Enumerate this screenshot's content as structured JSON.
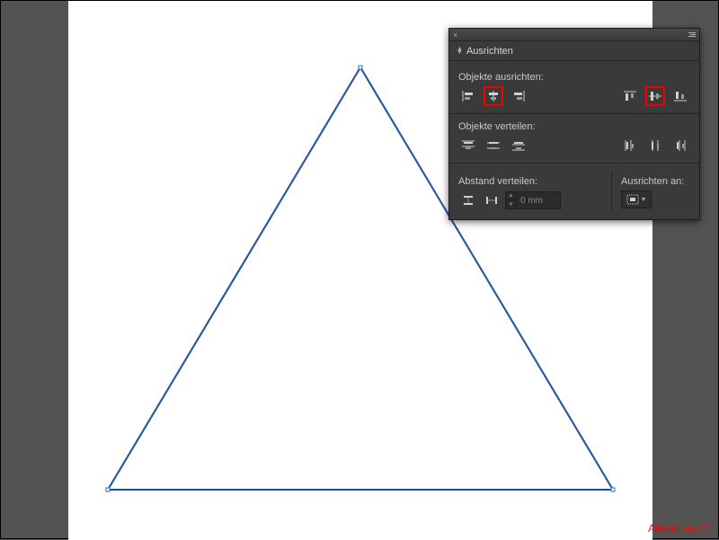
{
  "canvas": {
    "bg": "#535353",
    "artboard_bg": "#ffffff"
  },
  "shape": {
    "type": "triangle",
    "stroke": "#0a2a66",
    "select_stroke": "#2a6dcf"
  },
  "panel": {
    "title": "Ausrichten",
    "sections": {
      "align_objects": "Objekte ausrichten:",
      "distribute_objects": "Objekte verteilen:",
      "distribute_spacing": "Abstand verteilen:",
      "align_to": "Ausrichten an:"
    },
    "spacing_value": "0 mm",
    "icons": {
      "h_left": "align-left",
      "h_center": "align-h-center",
      "h_right": "align-right",
      "v_top": "align-top",
      "v_center": "align-v-center",
      "v_bottom": "align-bottom",
      "d_v_top": "distribute-v-top",
      "d_v_center": "distribute-v-center",
      "d_v_bottom": "distribute-v-bottom",
      "d_h_left": "distribute-h-left",
      "d_h_center": "distribute-h-center",
      "d_h_right": "distribute-h-right",
      "sp_v": "distribute-spacing-v",
      "sp_h": "distribute-spacing-h",
      "align_to_selection": "align-to-selection"
    },
    "highlighted": [
      "h_center",
      "v_center"
    ]
  },
  "caption": "Abbildung  03"
}
